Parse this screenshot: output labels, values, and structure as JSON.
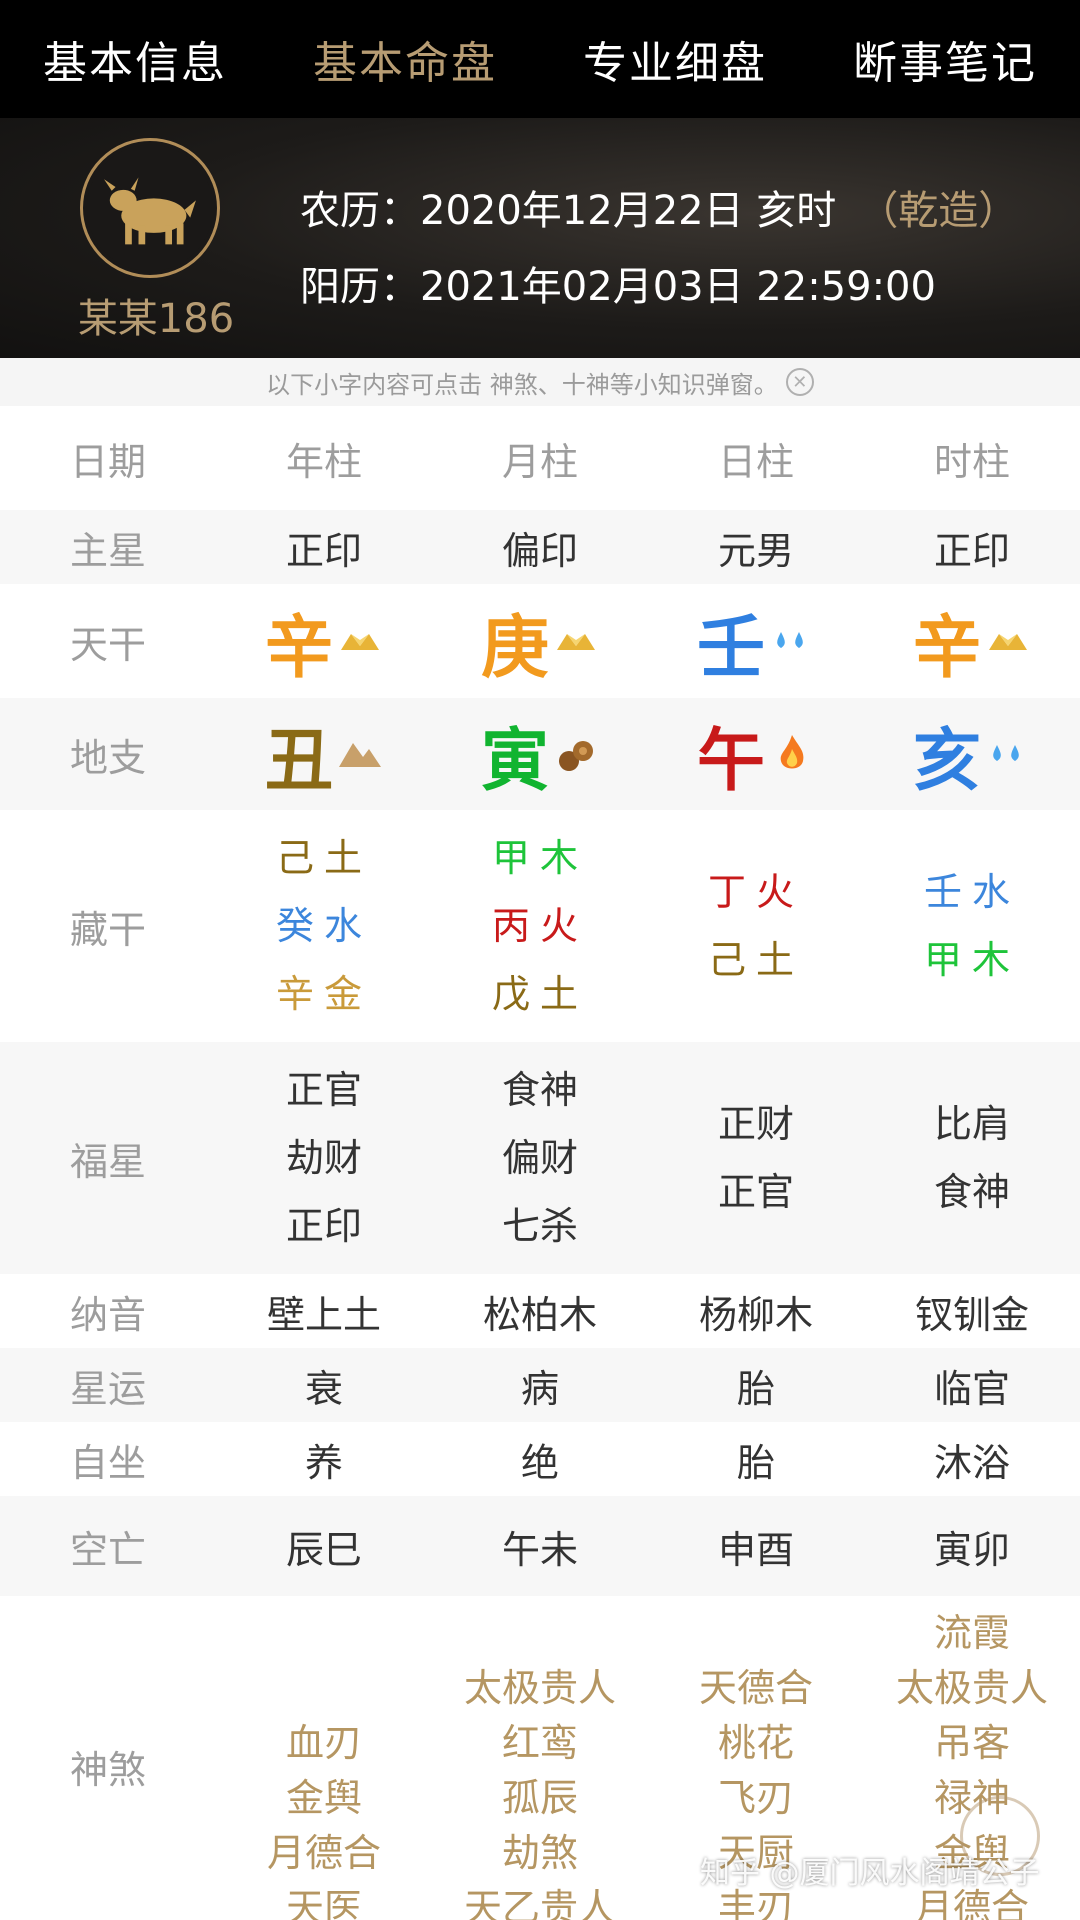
{
  "nav": {
    "tabs": [
      {
        "label": "基本信息"
      },
      {
        "label": "基本命盘"
      },
      {
        "label": "专业细盘"
      },
      {
        "label": "断事笔记"
      }
    ]
  },
  "header": {
    "username": "某某186",
    "lunar": "农历：2020年12月22日 亥时",
    "gender": "（乾造）",
    "solar": "阳历：2021年02月03日 22:59:00"
  },
  "hint": "以下小字内容可点击 神煞、十神等小知识弹窗。",
  "table": {
    "date_label": "日期",
    "columns": [
      "年柱",
      "月柱",
      "日柱",
      "时柱"
    ],
    "main_star": {
      "label": "主星",
      "values": [
        "正印",
        "偏印",
        "元男",
        "正印"
      ]
    },
    "stem": {
      "label": "天干",
      "values": [
        "辛",
        "庚",
        "壬",
        "辛"
      ]
    },
    "branch": {
      "label": "地支",
      "values": [
        "丑",
        "寅",
        "午",
        "亥"
      ]
    },
    "hidden": {
      "label": "藏干",
      "values": [
        [
          "己土",
          "癸水",
          "辛金"
        ],
        [
          "甲木",
          "丙火",
          "戊土"
        ],
        [
          "丁火",
          "己土"
        ],
        [
          "壬水",
          "甲木"
        ]
      ]
    },
    "fuxing": {
      "label": "福星",
      "values": [
        [
          "正官",
          "劫财",
          "正印"
        ],
        [
          "食神",
          "偏财",
          "七杀"
        ],
        [
          "正财",
          "正官"
        ],
        [
          "比肩",
          "食神"
        ]
      ]
    },
    "nayin": {
      "label": "纳音",
      "values": [
        "壁上土",
        "松柏木",
        "杨柳木",
        "钗钏金"
      ]
    },
    "xingyun": {
      "label": "星运",
      "values": [
        "衰",
        "病",
        "胎",
        "临官"
      ]
    },
    "zizuo": {
      "label": "自坐",
      "values": [
        "养",
        "绝",
        "胎",
        "沐浴"
      ]
    },
    "kongwang": {
      "label": "空亡",
      "values": [
        "辰巳",
        "午未",
        "申酉",
        "寅卯"
      ]
    },
    "shensha": {
      "label": "神煞",
      "values": [
        [
          "血刃",
          "金舆",
          "月德合",
          "天医"
        ],
        [
          "太极贵人",
          "红鸾",
          "孤辰",
          "劫煞",
          "天乙贵人"
        ],
        [
          "天德合",
          "桃花",
          "飞刃",
          "天厨",
          "丰刃"
        ],
        [
          "流霞",
          "太极贵人",
          "吊客",
          "禄神",
          "金舆",
          "月德合"
        ]
      ]
    }
  },
  "watermark": "知乎 @厦门风水阁靖公子",
  "colors": {
    "accent_gold": "#b79c73",
    "metal": "#f29a1e",
    "earth": "#8a6a16",
    "water": "#2f7fe0",
    "wood": "#11b430",
    "fire": "#c81a1a"
  }
}
